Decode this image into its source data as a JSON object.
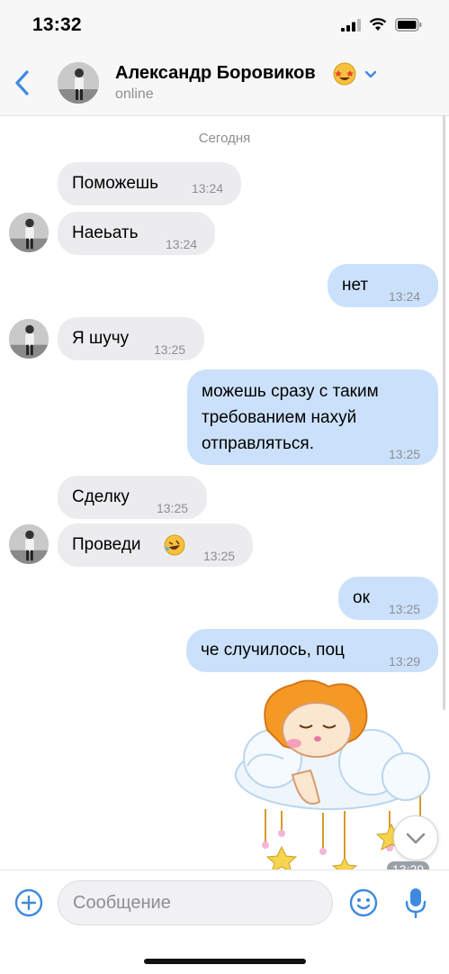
{
  "status_bar": {
    "time": "13:32"
  },
  "header": {
    "contact_name": "Александр Боровиков",
    "status": "online"
  },
  "chat": {
    "date_label": "Сегодня",
    "messages": [
      {
        "direction": "in",
        "text": "Поможешь",
        "time": "13:24"
      },
      {
        "direction": "in",
        "text": "Наеьать",
        "time": "13:24"
      },
      {
        "direction": "out",
        "text": "нет",
        "time": "13:24"
      },
      {
        "direction": "in",
        "text": "Я шучу",
        "time": "13:25"
      },
      {
        "direction": "out",
        "text": "можешь сразу с таким требованием нахуй отправляться.",
        "lines": [
          "можешь сразу с таким",
          "требованием нахуй",
          "отправляться."
        ],
        "time": "13:25"
      },
      {
        "direction": "in",
        "text": "Сделку",
        "time": "13:25"
      },
      {
        "direction": "in",
        "text": "Проведи",
        "time": "13:25"
      },
      {
        "direction": "out",
        "text": "ок",
        "time": "13:25"
      },
      {
        "direction": "out",
        "text": "че случилось, поц",
        "time": "13:29"
      }
    ],
    "sticker": {
      "name": "sleeping-lion-on-cloud",
      "time": "13:29"
    }
  },
  "composer": {
    "placeholder": "Сообщение"
  },
  "colors": {
    "accent": "#3f8ae0",
    "incoming_bubble": "#ececef",
    "outgoing_bubble": "#cbe1fb"
  }
}
